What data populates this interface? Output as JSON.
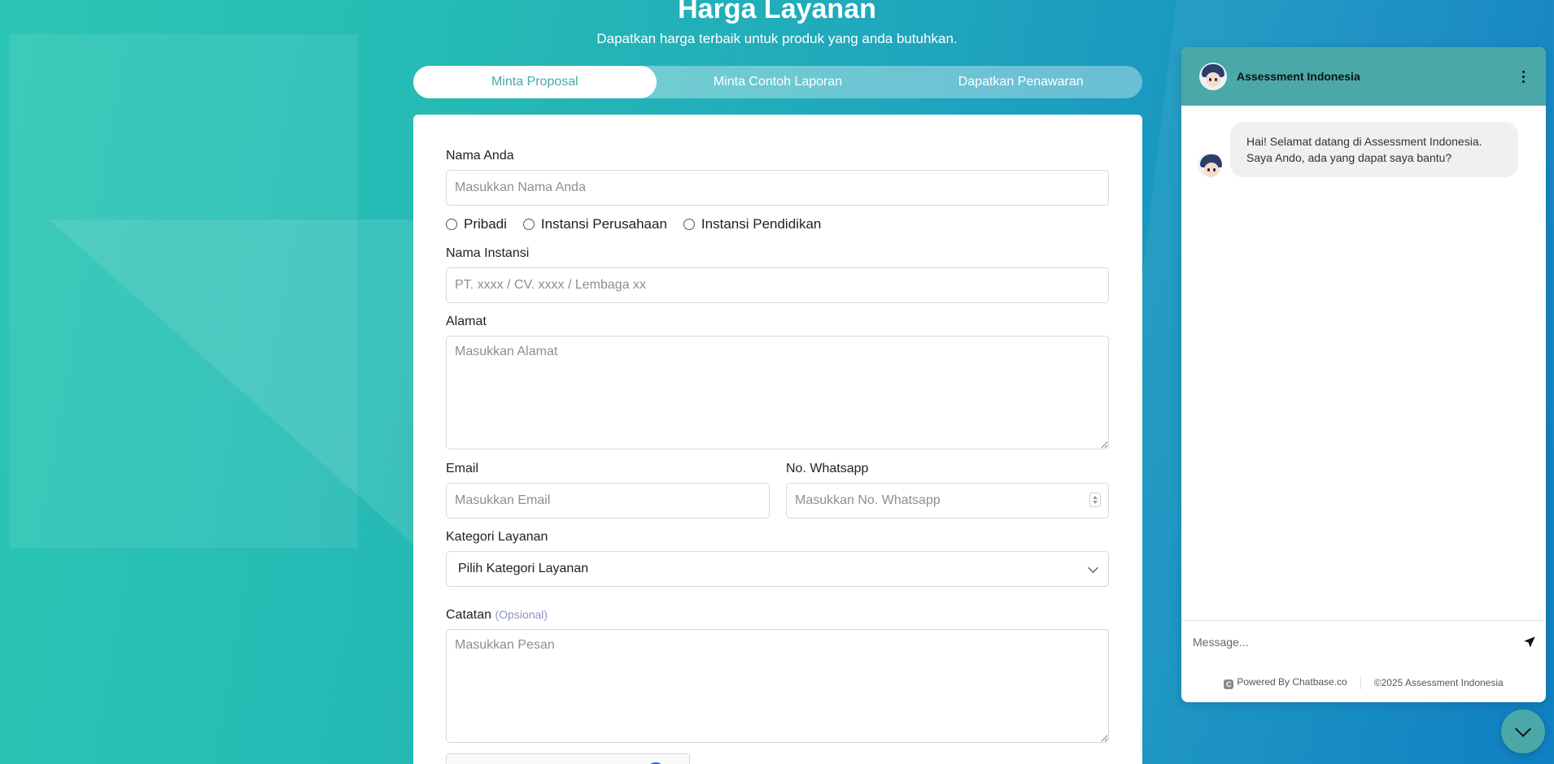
{
  "hero": {
    "title": "Harga Layanan",
    "subtitle": "Dapatkan harga terbaik untuk produk yang anda butuhkan."
  },
  "tabs": [
    {
      "label": "Minta Proposal",
      "active": true
    },
    {
      "label": "Minta Contoh Laporan",
      "active": false
    },
    {
      "label": "Dapatkan Penawaran",
      "active": false
    }
  ],
  "form": {
    "name": {
      "label": "Nama Anda",
      "placeholder": "Masukkan Nama Anda"
    },
    "type_options": [
      "Pribadi",
      "Instansi Perusahaan",
      "Instansi Pendidikan"
    ],
    "institution": {
      "label": "Nama Instansi",
      "placeholder": "PT. xxxx / CV. xxxx / Lembaga xx"
    },
    "address": {
      "label": "Alamat",
      "placeholder": "Masukkan Alamat"
    },
    "email": {
      "label": "Email",
      "placeholder": "Masukkan Email"
    },
    "whatsapp": {
      "label": "No. Whatsapp",
      "placeholder": "Masukkan No. Whatsapp"
    },
    "category": {
      "label": "Kategori Layanan",
      "selected": "Pilih Kategori Layanan"
    },
    "notes": {
      "label": "Catatan",
      "optional": "(Opsional)",
      "placeholder": "Masukkan Pesan"
    }
  },
  "chat": {
    "title": "Assessment Indonesia",
    "greeting_line1": "Hai! Selamat datang di Assessment Indonesia.",
    "greeting_line2": "Saya Ando, ada yang dapat saya bantu?",
    "input_placeholder": "Message...",
    "powered_by": "Powered By Chatbase.co",
    "copyright": "©2025 Assessment Indonesia"
  },
  "colors": {
    "accent": "#4aa8a8",
    "gradient_start": "#2cc7b4",
    "gradient_end": "#0f7fc2"
  }
}
